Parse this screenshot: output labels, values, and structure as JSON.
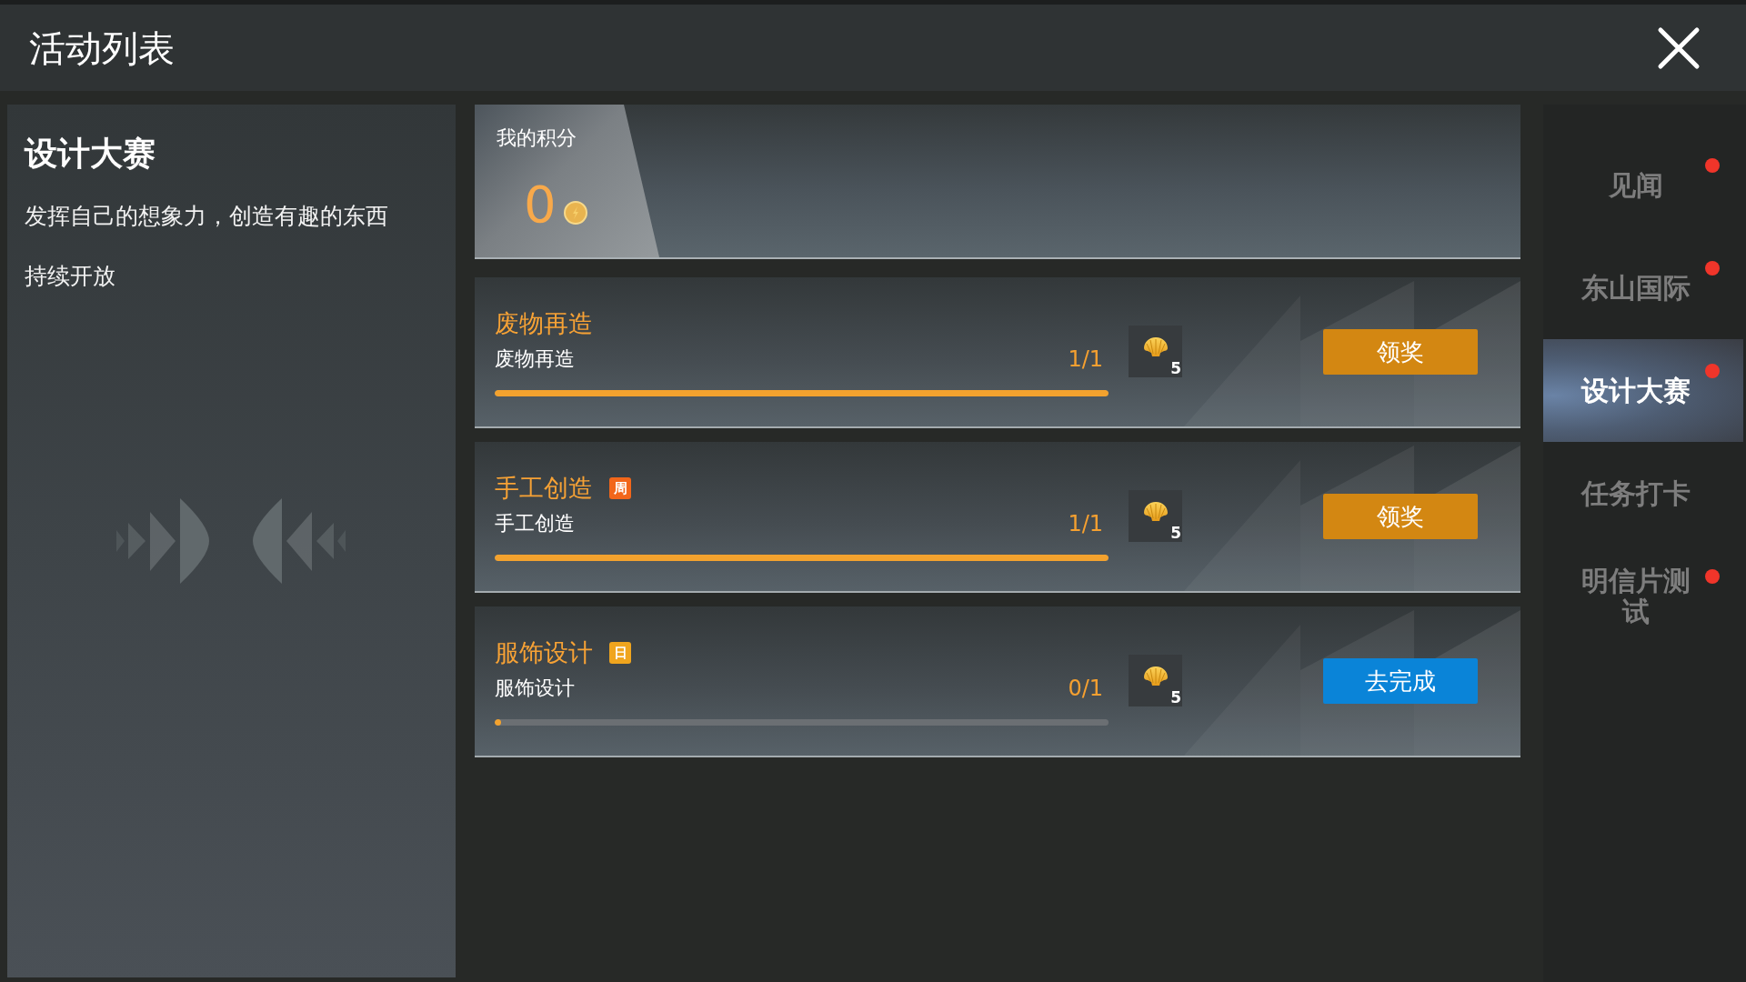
{
  "window": {
    "title": "活动列表"
  },
  "activity": {
    "title": "设计大赛",
    "description": "发挥自己的想象力，创造有趣的东西",
    "schedule": "持续开放"
  },
  "score": {
    "label": "我的积分",
    "value": "0"
  },
  "tasks": [
    {
      "title": "废物再造",
      "description": "废物再造",
      "progress": "1/1",
      "level": 1,
      "reward": "5",
      "action": {
        "label": "领奖",
        "kind": "claim"
      }
    },
    {
      "title": "手工创造",
      "tag": {
        "label": "周",
        "color": "#f2661a"
      },
      "description": "手工创造",
      "progress": "1/1",
      "level": 1,
      "reward": "5",
      "action": {
        "label": "领奖",
        "kind": "claim"
      }
    },
    {
      "title": "服饰设计",
      "tag": {
        "label": "日",
        "color": "#f0a51e"
      },
      "description": "服饰设计",
      "progress": "0/1",
      "level": 0.01,
      "reward": "5",
      "action": {
        "label": "去完成",
        "kind": "go"
      }
    }
  ],
  "tabs": [
    {
      "label": "见闻",
      "selected": false,
      "unread": true
    },
    {
      "label": "东山国际",
      "selected": false,
      "unread": true
    },
    {
      "label": "设计大赛",
      "selected": true,
      "unread": true
    },
    {
      "label": "任务打卡",
      "selected": false,
      "unread": false
    },
    {
      "label": "明信片测试",
      "selected": false,
      "unread": true
    }
  ]
}
